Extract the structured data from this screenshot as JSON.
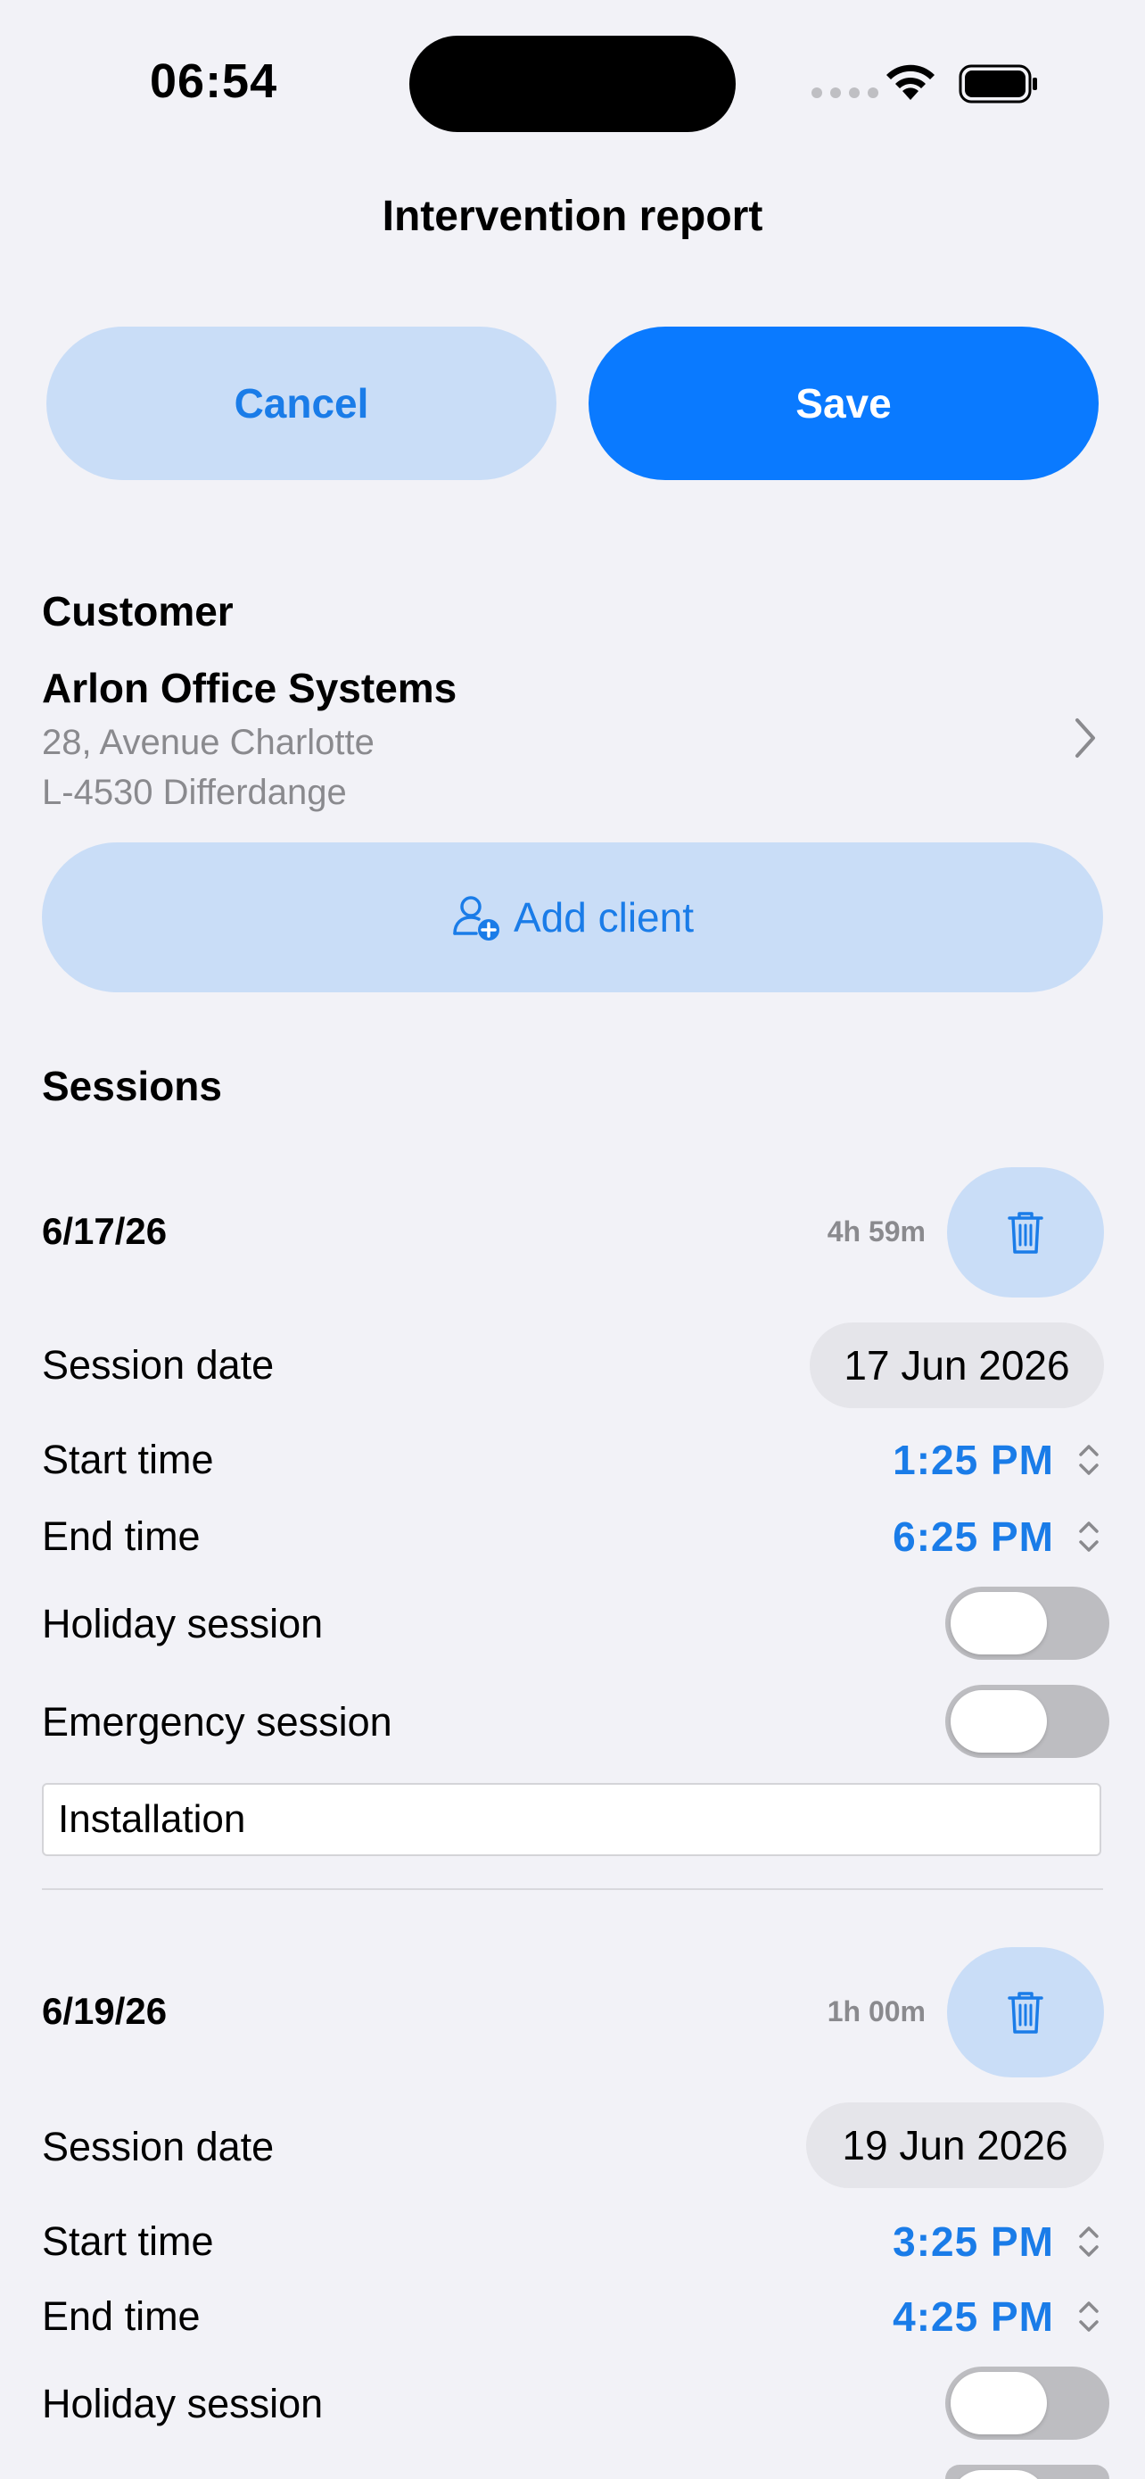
{
  "status_bar": {
    "time": "06:54"
  },
  "header": {
    "title": "Intervention report",
    "cancel_label": "Cancel",
    "save_label": "Save"
  },
  "customer": {
    "section_title": "Customer",
    "name": "Arlon Office Systems",
    "address_line1": "28, Avenue Charlotte",
    "address_line2": "L-4530 Differdange",
    "add_client_label": "Add client"
  },
  "sessions_title": "Sessions",
  "sessions": [
    {
      "date_short": "6/17/26",
      "duration": "4h 59m",
      "session_date_label": "Session date",
      "session_date": "17 Jun 2026",
      "start_label": "Start time",
      "start_time": "1:25 PM",
      "end_label": "End time",
      "end_time": "6:25 PM",
      "holiday_label": "Holiday session",
      "holiday": false,
      "emergency_label": "Emergency session",
      "emergency": false,
      "description": "Installation"
    },
    {
      "date_short": "6/19/26",
      "duration": "1h 00m",
      "session_date_label": "Session date",
      "session_date": "19 Jun 2026",
      "start_label": "Start time",
      "start_time": "3:25 PM",
      "end_label": "End time",
      "end_time": "4:25 PM",
      "holiday_label": "Holiday session",
      "holiday": false
    }
  ],
  "colors": {
    "accent": "#0a7aff",
    "accent_light": "#c9ddf7",
    "background": "#f2f2f7"
  },
  "icons": {
    "wifi": "wifi-icon",
    "battery": "battery-icon",
    "chevron": "chevron-right-icon",
    "add_client": "person-plus-icon",
    "trash": "trash-icon",
    "stepper": "up-down-chevron-icon"
  }
}
